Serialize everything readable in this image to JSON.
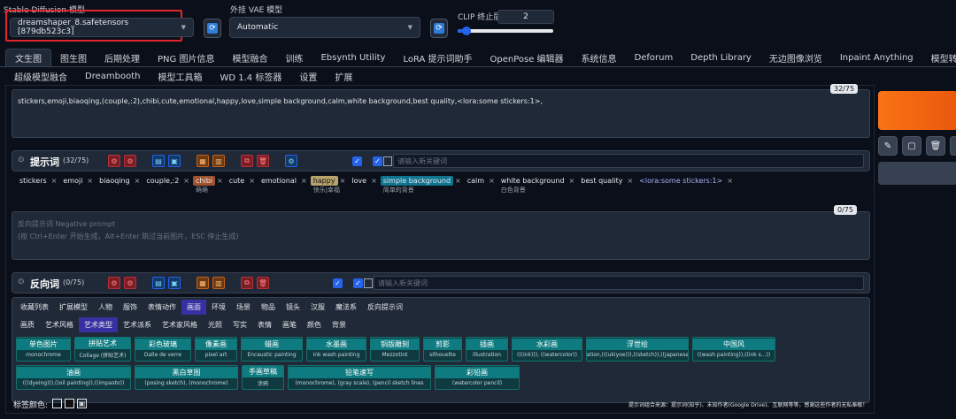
{
  "top": {
    "sd_model_label": "Stable Diffusion 模型",
    "sd_model_value": "dreamshaper_8.safetensors [879db523c3]",
    "vae_label": "外挂 VAE 模型",
    "vae_value": "Automatic",
    "clip_label": "CLIP 终止层数",
    "clip_value": "2",
    "clip_fraction": 0.09
  },
  "tabs_row1": [
    "文生图",
    "图生图",
    "后期处理",
    "PNG 图片信息",
    "模型融合",
    "训练",
    "Ebsynth Utility",
    "LoRA 提示词助手",
    "OpenPose 编辑器",
    "系统信息",
    "Deforum",
    "Depth Library",
    "无边图像浏览",
    "Inpaint Anything",
    "模型转换"
  ],
  "tabs_row2": [
    "超级模型融合",
    "Dreambooth",
    "模型工具箱",
    "WD 1.4 标签器",
    "设置",
    "扩展"
  ],
  "prompt": {
    "text": "stickers,emoji,biaoqing,(couple,:2),chibi,cute,emotional,happy,love,simple background,calm,white background,best quality,<lora:some stickers:1>,",
    "counter": "32/75",
    "section_title": "提示词",
    "section_count": "(32/75)",
    "new_keyword_placeholder": "请输入新关键词"
  },
  "tags": [
    {
      "text": "stickers",
      "style": "",
      "tr": ""
    },
    {
      "text": "emoji",
      "style": "",
      "tr": ""
    },
    {
      "text": "biaoqing",
      "style": "",
      "tr": ""
    },
    {
      "text": "couple,:2",
      "style": "",
      "tr": ""
    },
    {
      "text": "chibi",
      "style": "chibi",
      "tr": "萌萌"
    },
    {
      "text": "cute",
      "style": "",
      "tr": ""
    },
    {
      "text": "emotional",
      "style": "",
      "tr": ""
    },
    {
      "text": "happy",
      "style": "happy",
      "tr": "快乐|幸福"
    },
    {
      "text": "love",
      "style": "",
      "tr": ""
    },
    {
      "text": "simple background",
      "style": "simple",
      "tr": "简单的背景"
    },
    {
      "text": "calm",
      "style": "",
      "tr": ""
    },
    {
      "text": "white background",
      "style": "",
      "tr": "白色背景"
    },
    {
      "text": "best quality",
      "style": "",
      "tr": ""
    },
    {
      "text": "<lora:some stickers:1>",
      "style": "lora",
      "tr": ""
    }
  ],
  "negative": {
    "placeholder": "反向提示词 Negative prompt",
    "hint": "(按 Ctrl+Enter 开始生成，Alt+Enter 跳过当前图片，ESC 停止生成)",
    "counter": "0/75",
    "section_title": "反向词",
    "section_count": "(0/75)",
    "new_keyword_placeholder": "请输入新关键词"
  },
  "cat_row1": [
    "收藏列表",
    "扩展模型",
    "人物",
    "服饰",
    "表情动作",
    "画面",
    "环境",
    "场景",
    "物品",
    "镜头",
    "汉服",
    "魔法系",
    "反向提示词"
  ],
  "cat_row1_active": "画面",
  "cat_row2": [
    "画质",
    "艺术风格",
    "艺术类型",
    "艺术派系",
    "艺术家风格",
    "光照",
    "写实",
    "表情",
    "画笔",
    "颜色",
    "背景"
  ],
  "cat_row2_active": "艺术类型",
  "cards_row1": [
    {
      "h": "单色图片",
      "s": "monochrome"
    },
    {
      "h": "拼贴艺术",
      "s": "Collage (拼贴艺术)"
    },
    {
      "h": "彩色玻璃",
      "s": "Dalle de verre"
    },
    {
      "h": "像素画",
      "s": "pixel art"
    },
    {
      "h": "蜡画",
      "s": "Encaustic painting"
    },
    {
      "h": "水墨画",
      "s": "ink wash painting"
    },
    {
      "h": "铜版雕刻",
      "s": "Mezzotint"
    },
    {
      "h": "剪影",
      "s": "silhouette"
    },
    {
      "h": "插画",
      "s": "illustration"
    },
    {
      "h": "水彩画",
      "s": "(((ink))), ((watercolor))"
    },
    {
      "h": "浮世绘",
      "s": "illustration,(((ukiyoe))),((sketch)),((japanese_art))"
    },
    {
      "h": "中国风",
      "s": "((wash painting)),((ink s...))"
    }
  ],
  "cards_row2": [
    {
      "h": "油画",
      "s": "(((dyeing))),((oil painting)),((impasto))"
    },
    {
      "h": "黑白草图",
      "s": "(posing sketch), (monochrome)"
    },
    {
      "h": "手画草稿",
      "s": "涂鸦"
    },
    {
      "h": "铅笔速写",
      "s": "(monochrome), (gray scale), (pencil sketch lines"
    },
    {
      "h": "彩铅画",
      "s": "(watercolor pencil)"
    }
  ],
  "footer": {
    "tag_color_label": "标签颜色:",
    "credit": "提示词组合来源：提示词(知乎)、未知作者(Google Drive)、互联网等等，感谢这些作者的无私奉献！"
  },
  "colors": {
    "accent": "#f97316",
    "page_bg": "#0b0f19",
    "panel": "#1f2937",
    "highlight": "#e0262c"
  }
}
